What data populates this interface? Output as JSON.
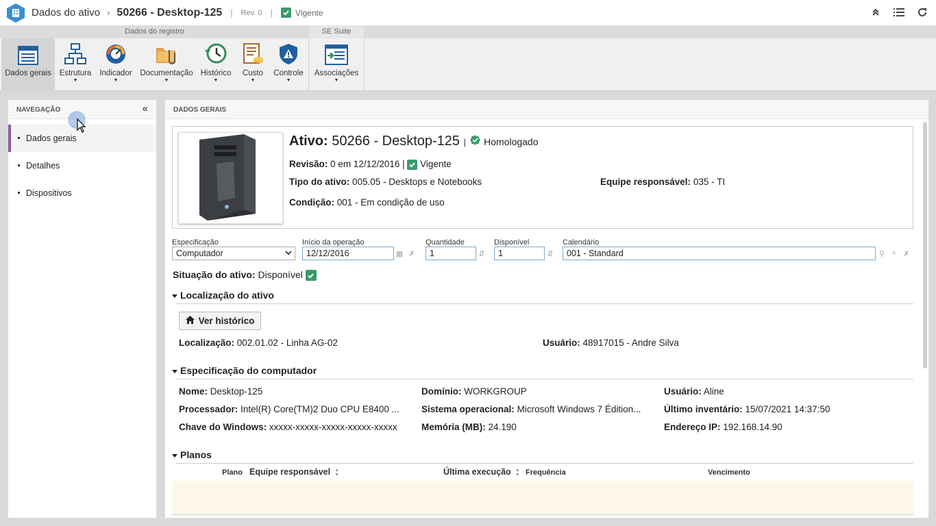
{
  "titlebar": {
    "screen_title": "Dados do ativo",
    "record": "50266 - Desktop-125",
    "revision": "Rev. 0",
    "status": "Vigente"
  },
  "ribbon": {
    "groups": [
      "Dados do registro",
      "SE Suite"
    ],
    "buttons": {
      "dados_gerais": "Dados gerais",
      "estrutura": "Estrutura",
      "indicador": "Indicador",
      "documentacao": "Documentação",
      "historico": "Histórico",
      "custo": "Custo",
      "controle": "Controle",
      "associacoes": "Associações"
    }
  },
  "nav": {
    "header": "NAVEGAÇÃO",
    "items": [
      "Dados gerais",
      "Detalhes",
      "Dispositivos"
    ]
  },
  "main": {
    "header": "DADOS GERAIS",
    "asset": {
      "label": "Ativo:",
      "value": "50266 - Desktop-125",
      "approval": "Homologado",
      "revisao_label": "Revisão:",
      "revisao_value": "0 em 12/12/2016",
      "revisao_status": "Vigente",
      "tipo_label": "Tipo do ativo:",
      "tipo_value": "005.05 - Desktops e Notebooks",
      "equipe_label": "Equipe responsável:",
      "equipe_value": "035 - TI",
      "condicao_label": "Condição:",
      "condicao_value": "001 - Em condição de uso"
    },
    "form": {
      "especificacao_label": "Especificação",
      "especificacao_value": "Computador",
      "inicio_label": "Início da operação",
      "inicio_value": "12/12/2016",
      "quantidade_label": "Quantidade",
      "quantidade_value": "1",
      "disponivel_label": "Disponível",
      "disponivel_value": "1",
      "calendario_label": "Calendário",
      "calendario_value": "001 - Standard"
    },
    "situacao_label": "Situação do ativo:",
    "situacao_value": "Disponível",
    "localizacao": {
      "title": "Localização do ativo",
      "button": "Ver histórico",
      "loc_label": "Localização:",
      "loc_value": "002.01.02 - Linha AG-02",
      "user_label": "Usuário:",
      "user_value": "48917015 - Andre Silva"
    },
    "computador": {
      "title": "Especificação do computador",
      "nome_label": "Nome:",
      "nome_value": "Desktop-125",
      "dominio_label": "Domínio:",
      "dominio_value": "WORKGROUP",
      "usuario_label": "Usuário:",
      "usuario_value": "Aline",
      "proc_label": "Processador:",
      "proc_value": "Intel(R) Core(TM)2 Duo CPU E8400 ...",
      "so_label": "Sistema operacional:",
      "so_value": "Microsoft Windows 7 Édition...",
      "inv_label": "Último inventário:",
      "inv_value": "15/07/2021 14:37:50",
      "chave_label": "Chave do Windows:",
      "chave_value": "xxxxx-xxxxx-xxxxx-xxxxx-xxxxx",
      "mem_label": "Memória (MB):",
      "mem_value": "24.190",
      "ip_label": "Endereço IP:",
      "ip_value": "192.168.14.90"
    },
    "planos": {
      "title": "Planos",
      "columns": [
        "Plano",
        "Equipe responsável",
        "Última execução",
        "Frequência",
        "Vencimento"
      ]
    }
  }
}
